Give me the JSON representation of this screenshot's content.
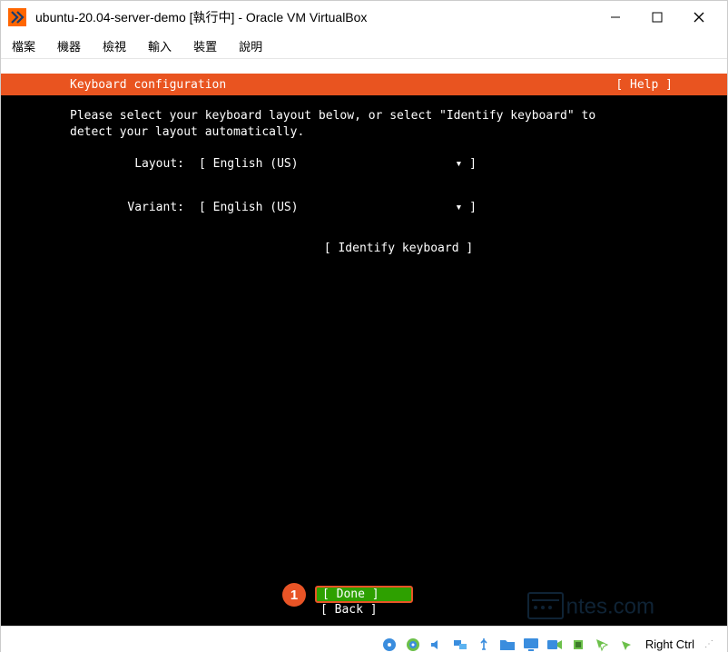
{
  "window": {
    "title": "ubuntu-20.04-server-demo [執行中] - Oracle VM VirtualBox",
    "app_icon_letter": "V"
  },
  "menu": {
    "file": "檔案",
    "machine": "機器",
    "view": "檢視",
    "input": "輸入",
    "devices": "裝置",
    "help": "說明"
  },
  "installer": {
    "title": "Keyboard configuration",
    "help": "[ Help ]",
    "instruction": "Please select your keyboard layout below, or select \"Identify keyboard\" to\ndetect your layout automatically.",
    "layout_label": "Layout:",
    "layout_value": "[ English (US)",
    "layout_close": "▾ ]",
    "variant_label": "Variant:",
    "variant_value": "[ English (US)",
    "variant_close": "▾ ]",
    "identify": "[ Identify keyboard ]",
    "done": "[ Done         ]",
    "back": "[ Back         ]"
  },
  "callout": {
    "number": "1"
  },
  "statusbar": {
    "hostkey": "Right Ctrl"
  },
  "watermark": {
    "text": "ntes.com"
  }
}
